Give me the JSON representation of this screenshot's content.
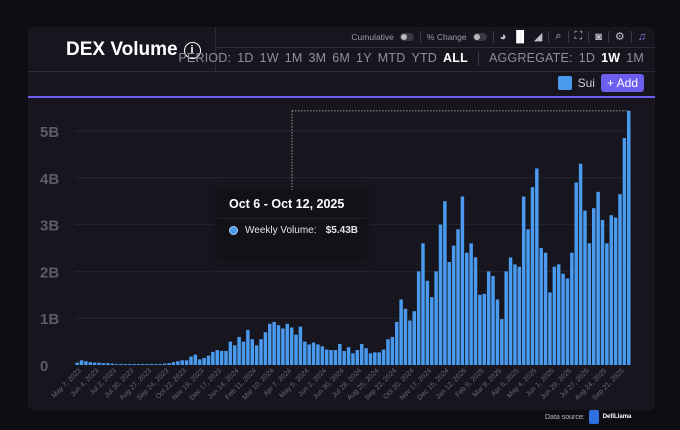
{
  "header": {
    "title": "DEX Volume",
    "info_icon": "info-circle-icon"
  },
  "controls": {
    "cumulative_label": "Cumulative",
    "percent_change_label": "% Change",
    "icons": [
      "pie-chart-icon",
      "bar-chart-icon",
      "area-chart-icon",
      "search-icon",
      "fullscreen-icon",
      "camera-icon",
      "gear-icon",
      "bell-icon"
    ],
    "period_label": "PERIOD:",
    "periods": [
      "1D",
      "1W",
      "1M",
      "3M",
      "6M",
      "1Y",
      "MTD",
      "YTD",
      "ALL"
    ],
    "period_selected": "ALL",
    "aggregate_label": "AGGREGATE:",
    "aggregates": [
      "1D",
      "1W",
      "1M"
    ],
    "aggregate_selected": "1W"
  },
  "legend": {
    "series": "Sui",
    "add_label": "+ Add"
  },
  "colors": {
    "bar": "#4a9bf0",
    "accent": "#6c5ff0"
  },
  "tooltip": {
    "title": "Oct 6 - Oct 12, 2025",
    "label": "Weekly Volume:",
    "value": "$5.43B"
  },
  "footer": {
    "label": "Data source:",
    "brand": "DefiLlama"
  },
  "chart_data": {
    "type": "bar",
    "title": "",
    "xlabel": "",
    "ylabel": "",
    "ylim": [
      0,
      5.5
    ],
    "grid": true,
    "y_ticks": [
      "0",
      "1B",
      "2B",
      "3B",
      "4B",
      "5B"
    ],
    "y_tick_values": [
      0,
      1,
      2,
      3,
      4,
      5
    ],
    "x_tick_labels": [
      "May 7, 2023",
      "Jun 4, 2023",
      "Jul 2, 2023",
      "Jul 30, 2023",
      "Aug 27, 2023",
      "Sep 24, 2023",
      "Oct 22, 2023",
      "Nov 19, 2023",
      "Dec 17, 2023",
      "Jan 14, 2024",
      "Feb 11, 2024",
      "Mar 10, 2024",
      "Apr 7, 2024",
      "May 5, 2024",
      "Jun 2, 2024",
      "Jun 30, 2024",
      "Jul 28, 2024",
      "Aug 25, 2024",
      "Sep 22, 2024",
      "Oct 20, 2024",
      "Nov 17, 2024",
      "Dec 15, 2024",
      "Jan 12, 2025",
      "Feb 9, 2025",
      "Mar 9, 2025",
      "Apr 6, 2025",
      "May 4, 2025",
      "Jun 1, 2025",
      "Jun 29, 2025",
      "Jul 27, 2025",
      "Aug 24, 2025",
      "Sep 21, 2025"
    ],
    "series": [
      {
        "name": "Sui",
        "unit": "B USD",
        "values": [
          0.05,
          0.1,
          0.08,
          0.06,
          0.05,
          0.05,
          0.04,
          0.04,
          0.03,
          0.02,
          0.02,
          0.02,
          0.02,
          0.02,
          0.02,
          0.02,
          0.02,
          0.02,
          0.02,
          0.02,
          0.03,
          0.04,
          0.06,
          0.08,
          0.1,
          0.1,
          0.18,
          0.22,
          0.12,
          0.15,
          0.2,
          0.28,
          0.32,
          0.3,
          0.3,
          0.5,
          0.42,
          0.6,
          0.5,
          0.75,
          0.55,
          0.42,
          0.55,
          0.7,
          0.88,
          0.92,
          0.85,
          0.78,
          0.88,
          0.8,
          0.65,
          0.82,
          0.5,
          0.44,
          0.48,
          0.44,
          0.4,
          0.33,
          0.32,
          0.32,
          0.45,
          0.3,
          0.38,
          0.25,
          0.32,
          0.45,
          0.36,
          0.25,
          0.27,
          0.27,
          0.33,
          0.55,
          0.6,
          0.92,
          1.4,
          1.2,
          0.95,
          1.15,
          2.0,
          2.6,
          1.8,
          1.45,
          2.0,
          3.0,
          3.5,
          2.2,
          2.55,
          2.9,
          3.6,
          2.4,
          2.6,
          2.3,
          1.5,
          1.52,
          2.0,
          1.9,
          1.4,
          0.98,
          2.0,
          2.3,
          2.15,
          2.1,
          3.6,
          2.9,
          3.8,
          4.2,
          2.5,
          2.4,
          1.55,
          2.1,
          2.15,
          1.95,
          1.85,
          2.4,
          3.9,
          4.3,
          3.3,
          2.6,
          3.35,
          3.7,
          3.1,
          2.6,
          3.2,
          3.15,
          3.65,
          4.85,
          5.43
        ]
      }
    ]
  }
}
